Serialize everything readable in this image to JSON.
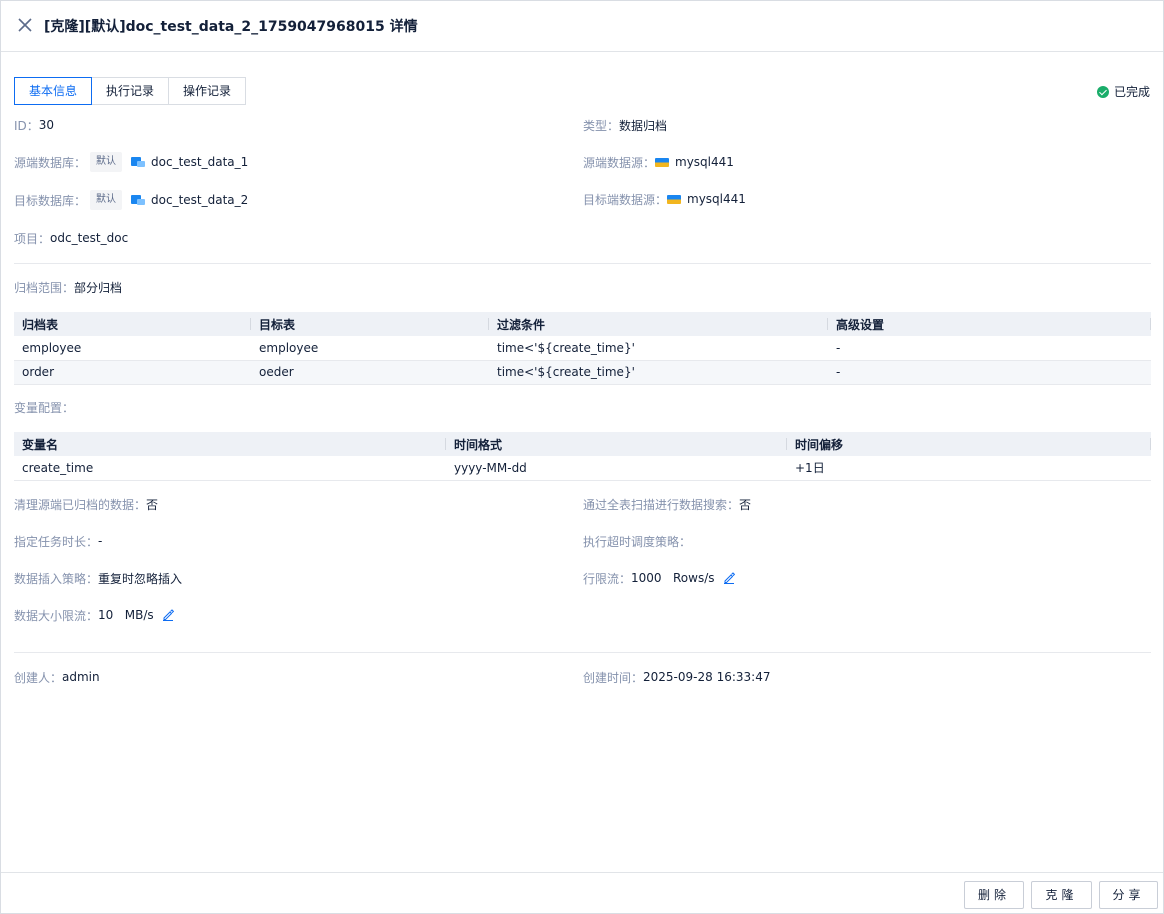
{
  "header": {
    "title": "[克隆][默认]doc_test_data_2_1759047968015 详情"
  },
  "tabs": [
    {
      "label": "基本信息"
    },
    {
      "label": "执行记录"
    },
    {
      "label": "操作记录"
    }
  ],
  "status": {
    "label": "已完成",
    "color": "#1aad6a"
  },
  "info": {
    "id_label": "ID：",
    "id_value": "30",
    "type_label": "类型：",
    "type_value": "数据归档",
    "src_db_label": "源端数据库：",
    "src_db_tag": "默认",
    "src_db_value": "doc_test_data_1",
    "src_ds_label": "源端数据源：",
    "src_ds_value": "mysql441",
    "tgt_db_label": "目标数据库：",
    "tgt_db_tag": "默认",
    "tgt_db_value": "doc_test_data_2",
    "tgt_ds_label": "目标端数据源：",
    "tgt_ds_value": "mysql441",
    "project_label": "项目：",
    "project_value": "odc_test_doc"
  },
  "archive": {
    "scope_label": "归档范围：",
    "scope_value": "部分归档",
    "columns": [
      "归档表",
      "目标表",
      "过滤条件",
      "高级设置"
    ],
    "rows": [
      [
        "employee",
        "employee",
        "time<'${create_time}'",
        "-"
      ],
      [
        "order",
        "oeder",
        "time<'${create_time}'",
        "-"
      ]
    ]
  },
  "variables": {
    "label": "变量配置：",
    "columns": [
      "变量名",
      "时间格式",
      "时间偏移"
    ],
    "rows": [
      [
        "create_time",
        "yyyy-MM-dd",
        "+1日"
      ]
    ]
  },
  "settings": {
    "clean_label": "清理源端已归档的数据：",
    "clean_value": "否",
    "fullscan_label": "通过全表扫描进行数据搜索：",
    "fullscan_value": "否",
    "duration_label": "指定任务时长：",
    "duration_value": "-",
    "timeout_label": "执行超时调度策略：",
    "timeout_value": "",
    "insert_label": "数据插入策略：",
    "insert_value": "重复时忽略插入",
    "rowlimit_label": "行限流：",
    "rowlimit_value": "1000   Rows/s",
    "sizelimit_label": "数据大小限流：",
    "sizelimit_value": "10   MB/s"
  },
  "meta": {
    "creator_label": "创建人：",
    "creator_value": "admin",
    "created_label": "创建时间：",
    "created_value": "2025-09-28 16:33:47"
  },
  "footer": {
    "delete_label": "删除",
    "clone_label": "克隆",
    "share_label": "分享"
  },
  "colors": {
    "primary": "#0d6cf2",
    "success": "#1aad6a"
  }
}
